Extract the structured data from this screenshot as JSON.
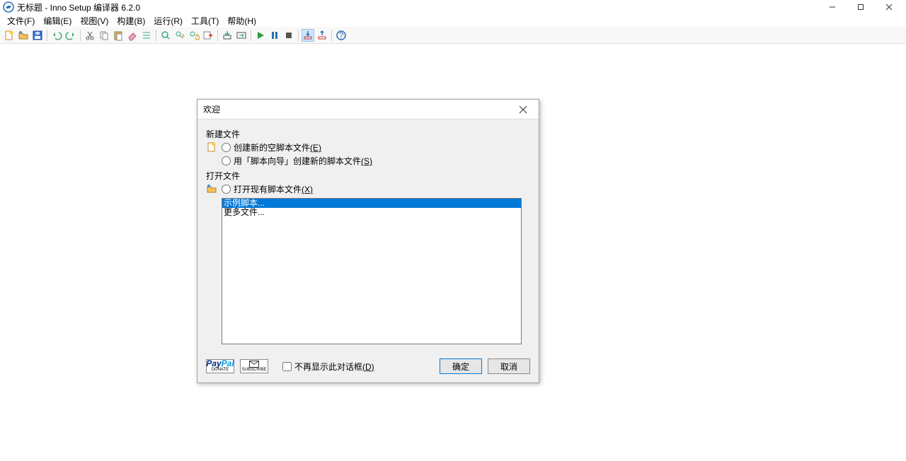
{
  "titlebar": {
    "title": "无标题 - Inno Setup 编译器 6.2.0"
  },
  "menubar": {
    "file": "文件(F)",
    "edit": "编辑(E)",
    "view": "视图(V)",
    "build": "构建(B)",
    "run": "运行(R)",
    "tools": "工具(T)",
    "help": "帮助(H)"
  },
  "dialog": {
    "title": "欢迎",
    "section_new_label": "新建文件",
    "opt_new_empty": "创建新的空脚本文件",
    "opt_new_empty_accel": "(E)",
    "opt_new_wizard": "用「脚本向导」创建新的脚本文件",
    "opt_new_wizard_accel": "(S)",
    "section_open_label": "打开文件",
    "opt_open_existing": "打开现有脚本文件",
    "opt_open_existing_accel": "(X)",
    "list_items": [
      "示例脚本...",
      "更多文件..."
    ],
    "paypal_top": "PayPal",
    "paypal_bottom": "DONATE",
    "subscribe_bottom": "SUBSCRIBE",
    "dont_show": "不再显示此对话框",
    "dont_show_accel": "(D)",
    "ok": "确定",
    "cancel": "取消"
  }
}
